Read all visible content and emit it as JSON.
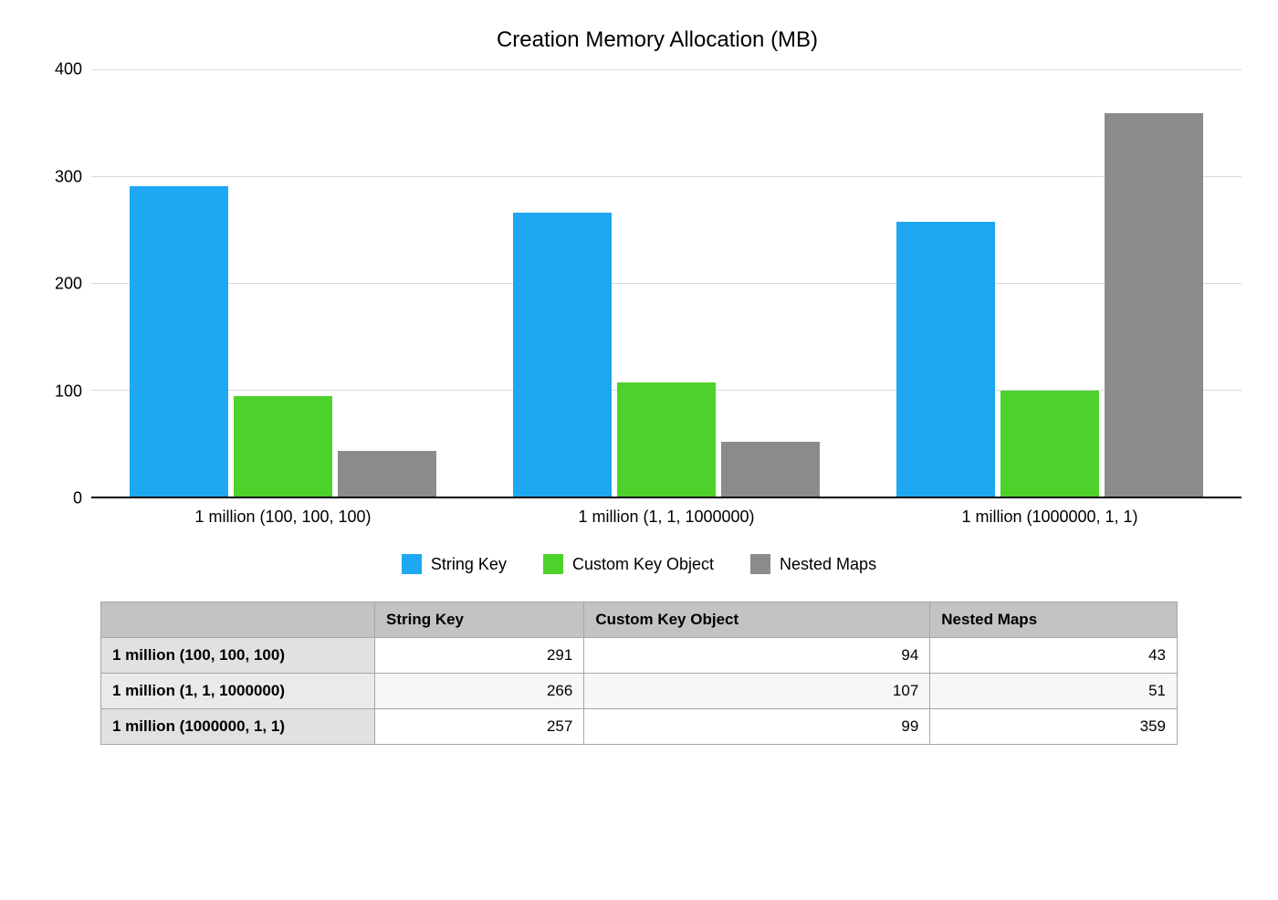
{
  "chart_data": {
    "type": "bar",
    "title": "Creation Memory Allocation (MB)",
    "ylabel": "",
    "xlabel": "",
    "ylim": [
      0,
      400
    ],
    "yticks": [
      0,
      100,
      200,
      300,
      400
    ],
    "categories": [
      "1 million (100, 100, 100)",
      "1 million (1, 1, 1000000)",
      "1 million (1000000, 1, 1)"
    ],
    "series": [
      {
        "name": "String Key",
        "color": "#1ea8f2",
        "values": [
          291,
          266,
          257
        ]
      },
      {
        "name": "Custom Key Object",
        "color": "#4cd22b",
        "values": [
          94,
          107,
          99
        ]
      },
      {
        "name": "Nested Maps",
        "color": "#8b8b8b",
        "values": [
          43,
          51,
          359
        ]
      }
    ]
  },
  "table": {
    "headers": [
      "",
      "String Key",
      "Custom Key Object",
      "Nested Maps"
    ],
    "rows": [
      {
        "label": "1 million (100, 100, 100)",
        "cells": [
          291,
          94,
          43
        ]
      },
      {
        "label": "1 million (1, 1, 1000000)",
        "cells": [
          266,
          107,
          51
        ]
      },
      {
        "label": "1 million (1000000, 1, 1)",
        "cells": [
          257,
          99,
          359
        ]
      }
    ]
  }
}
